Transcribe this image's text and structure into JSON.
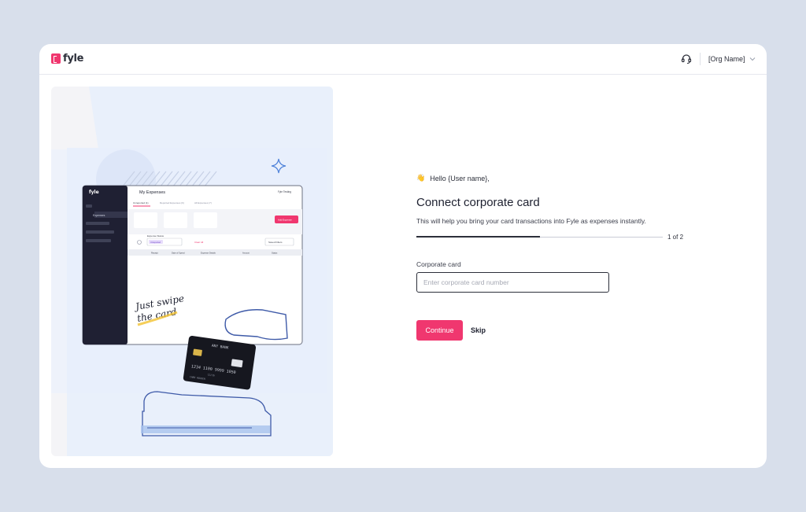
{
  "header": {
    "logo_text": "fyle",
    "help_icon": "headset-icon",
    "org_name": "[Org Name]",
    "org_chevron_icon": "chevron-down-icon"
  },
  "illustration": {
    "app_title": "My Expenses",
    "sidebar_logo": "fyle",
    "sidebar_item": "Expenses",
    "user_menu": "Fyle Testing",
    "tabs": [
      "Unreported (1)",
      "Reported Expenses (6)",
      "All Expenses (7)"
    ],
    "add_button": "Add Expense",
    "filter_label": "Expense Status",
    "filter_value": "Unreported",
    "clear_all": "Clear All",
    "saved_filters": "Saved Filters",
    "columns": [
      "Receipt",
      "Date of Spend",
      "Expense Details",
      "Amount",
      "Status"
    ],
    "handwriting_line1": "Just swipe",
    "handwriting_line2": "the card",
    "card_bank": "ANY BANK",
    "card_number": "1234 1100 9999 1050",
    "card_expiry": "12/26",
    "card_holder": "CARD HOLDER"
  },
  "form": {
    "greeting_icon": "waving-hand-icon",
    "greeting": "Hello {User name},",
    "title": "Connect corporate card",
    "subtitle": "This will help you bring your card transactions into Fyle as expenses instantly.",
    "progress": 0.5,
    "step_label": "1 of 2",
    "card_label": "Corporate card",
    "card_placeholder": "Enter corporate card number",
    "card_value": "",
    "continue_label": "Continue",
    "skip_label": "Skip"
  },
  "colors": {
    "brand": "#f0376f",
    "text": "#2c2f3a",
    "background": "#d8dfeb"
  }
}
